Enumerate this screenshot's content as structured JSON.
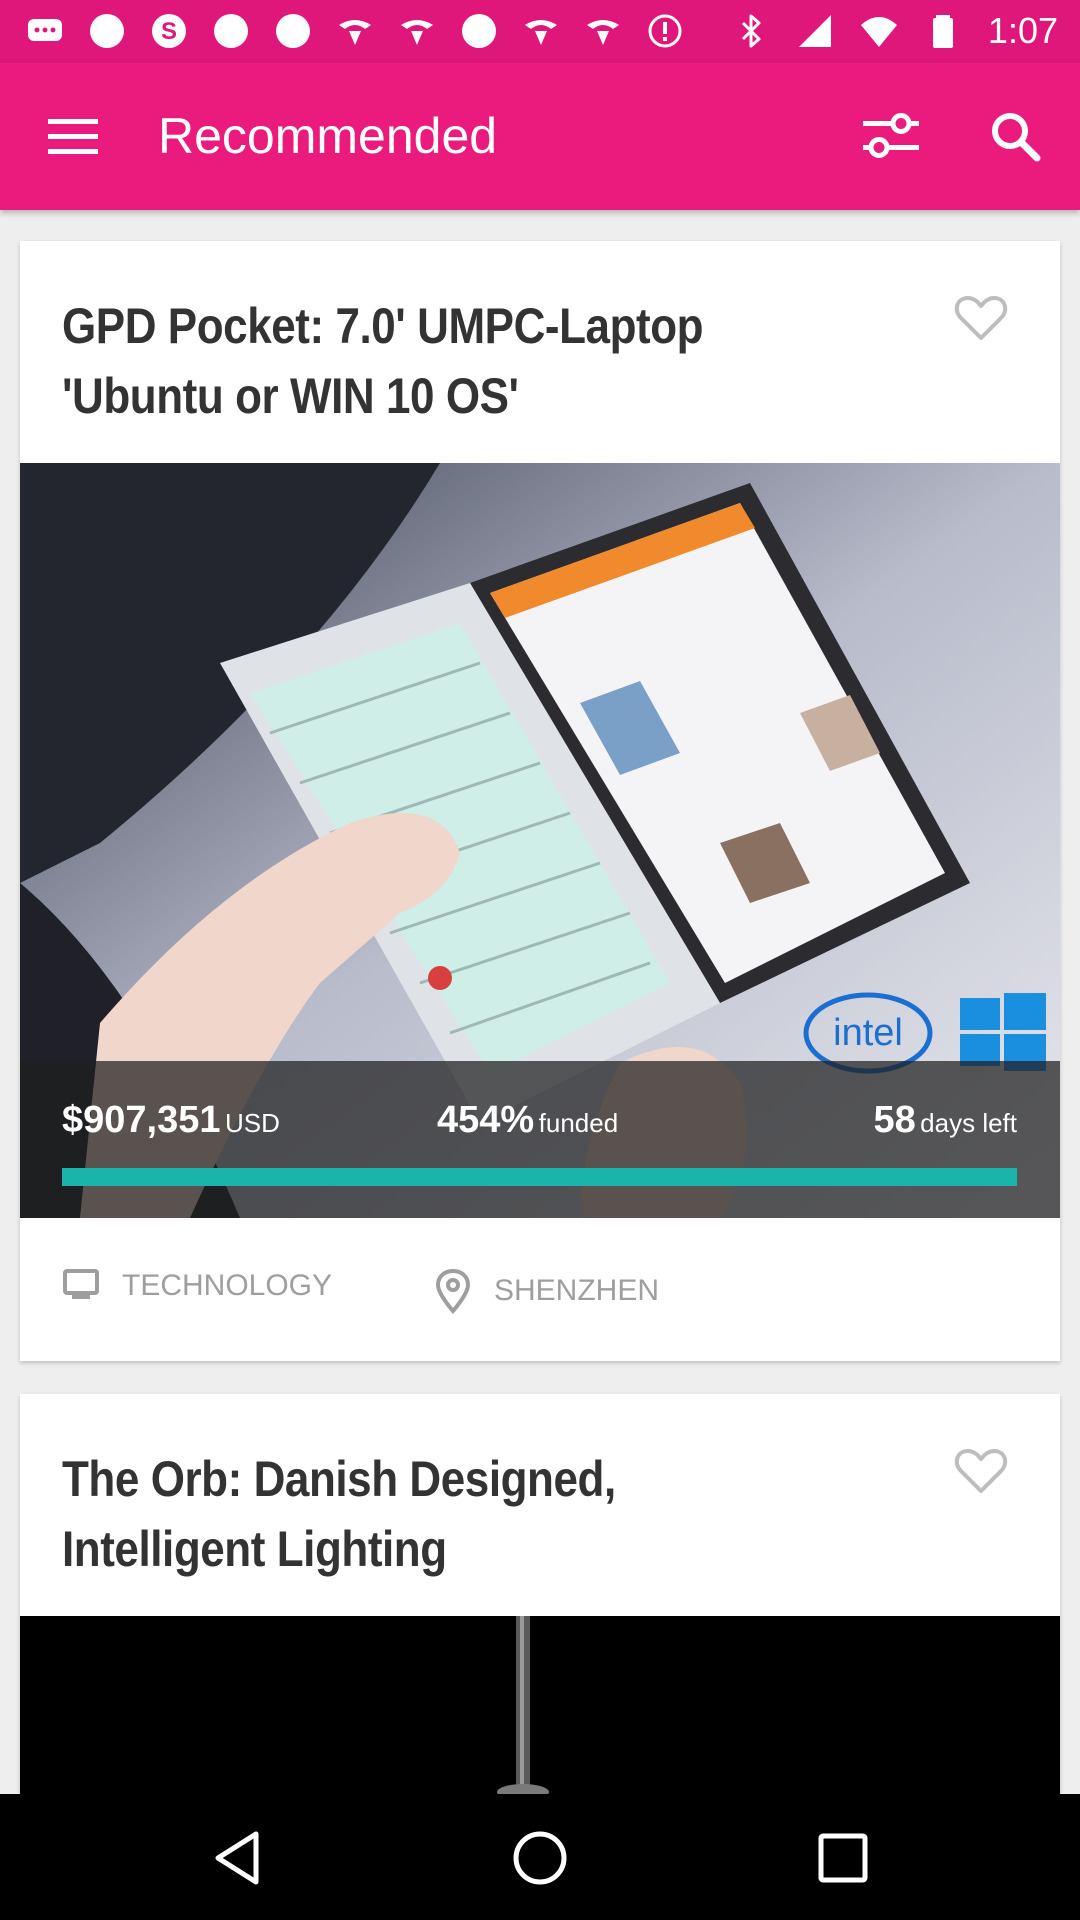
{
  "status_bar": {
    "time": "1:07",
    "left_icons": [
      "chat-icon",
      "notification-dot-icon",
      "app-s-icon",
      "notification-dot-icon",
      "notification-dot-icon",
      "fan-icon",
      "fan-icon",
      "notification-dot-icon",
      "fan-icon",
      "fan-icon",
      "info-icon"
    ],
    "right_icons": [
      "bluetooth-icon",
      "signal-icon",
      "wifi-icon",
      "battery-icon"
    ]
  },
  "app_bar": {
    "title": "Recommended",
    "background": "#ea1b7c"
  },
  "cards": [
    {
      "title": "GPD Pocket: 7.0' UMPC-Laptop 'Ubuntu or WIN 10 OS'",
      "amount": "$907,351",
      "currency": "USD",
      "percent": "454%",
      "percent_label": "funded",
      "days": "58",
      "days_label": "days left",
      "progress_fraction": 1.0,
      "progress_color": "#19b4ab",
      "category": "TECHNOLOGY",
      "location": "SHENZHEN"
    },
    {
      "title": "The Orb: Danish Designed, Intelligent Lighting"
    }
  ]
}
